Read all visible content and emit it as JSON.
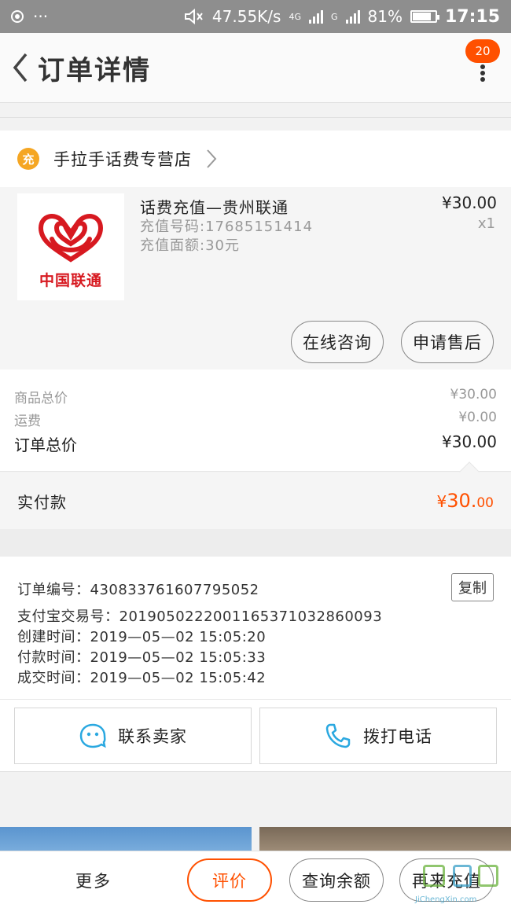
{
  "status_bar": {
    "dots": "···",
    "speed": "47.55K/s",
    "network_4g": "4G",
    "network_g": "G",
    "battery": "81%",
    "battery_level": 0.81,
    "time": "17:15"
  },
  "header": {
    "title": "订单详情",
    "badge_count": "20"
  },
  "shop": {
    "logo_glyph": "充",
    "name": "手拉手话费专营店"
  },
  "product": {
    "thumb_text": "中国联通",
    "title": "话费充值—贵州联通",
    "phone_line": "充值号码:17685151414",
    "amount_line": "充值面额:30元",
    "price": "¥30.00",
    "qty": "x1",
    "btn_consult": "在线咨询",
    "btn_aftersale": "申请售后"
  },
  "summary": {
    "goods_label": "商品总价",
    "goods_value": "¥30.00",
    "shipping_label": "运费",
    "shipping_value": "¥0.00",
    "total_label": "订单总价",
    "total_value": "¥30.00"
  },
  "paid": {
    "label": "实付款",
    "yen": "¥",
    "amount_main": "30.",
    "amount_decimal": "00"
  },
  "order_info": {
    "order_no": "订单编号：430833761607795052",
    "alipay_no": "支付宝交易号：2019050222001165371032860093",
    "created": "创建时间：2019—05—02 15:05:20",
    "paid": "付款时间：2019—05—02 15:05:33",
    "completed": "成交时间：2019—05—02 15:05:42",
    "copy_label": "复制"
  },
  "contact": {
    "seller_label": "联系卖家",
    "phone_label": "拨打电话"
  },
  "bottom_bar": {
    "more": "更多",
    "review": "评价",
    "balance": "查询余额",
    "recharge": "再来充值"
  },
  "watermark": {
    "text": "JiChengXin.com"
  },
  "colors": {
    "accent": "#ff5000",
    "unicom_red": "#d71920",
    "chat_blue": "#2aa8e0"
  }
}
